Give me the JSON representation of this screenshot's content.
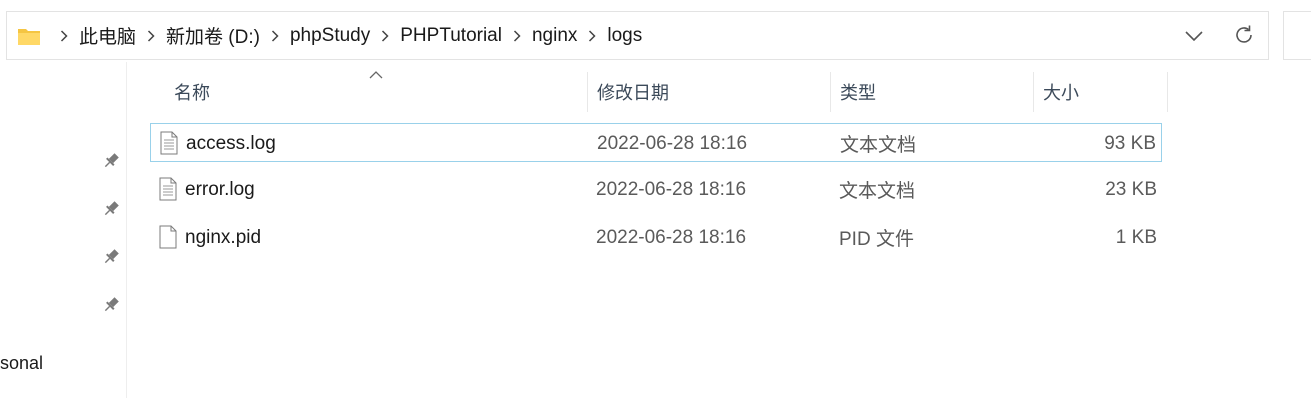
{
  "address_bar": {
    "crumbs": [
      "此电脑",
      "新加卷 (D:)",
      "phpStudy",
      "PHPTutorial",
      "nginx",
      "logs"
    ]
  },
  "nav": {
    "personal_label": "sonal"
  },
  "columns": {
    "name": "名称",
    "date": "修改日期",
    "type": "类型",
    "size": "大小"
  },
  "files": [
    {
      "name": "access.log",
      "date": "2022-06-28 18:16",
      "type": "文本文档",
      "size": "93 KB",
      "icon": "text-file-icon",
      "selected": true
    },
    {
      "name": "error.log",
      "date": "2022-06-28 18:16",
      "type": "文本文档",
      "size": "23 KB",
      "icon": "text-file-icon",
      "selected": false
    },
    {
      "name": "nginx.pid",
      "date": "2022-06-28 18:16",
      "type": "PID 文件",
      "size": "1 KB",
      "icon": "blank-file-icon",
      "selected": false
    }
  ],
  "colors": {
    "selection_border": "#99d1ea",
    "folder": "#f5c542"
  }
}
